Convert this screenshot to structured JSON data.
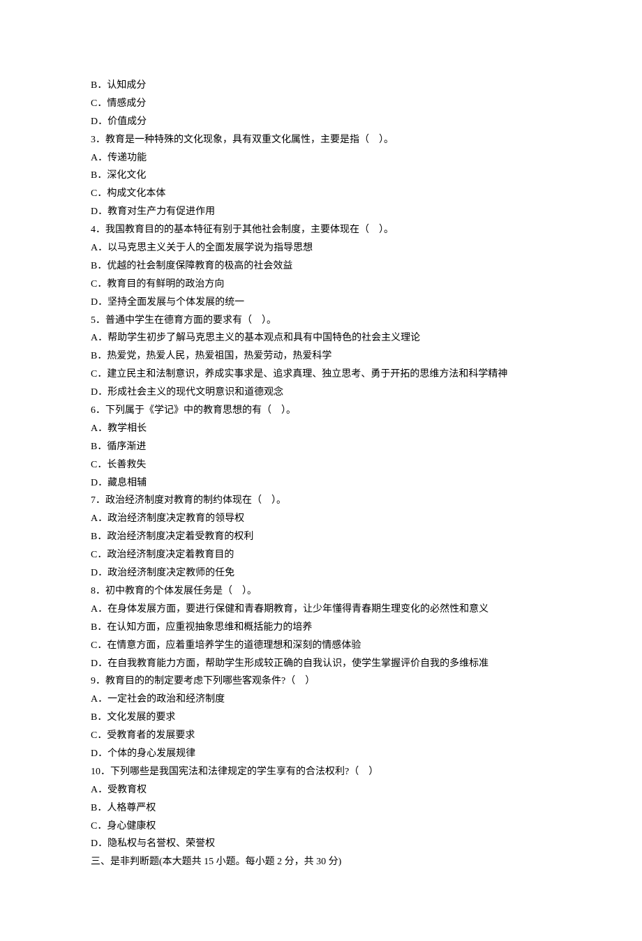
{
  "lines": [
    "B．认知成分",
    "C．情感成分",
    "D．价值成分",
    "3．教育是一种特殊的文化现象，具有双重文化属性，主要是指（　）。",
    "A．传递功能",
    "B．深化文化",
    "C．构成文化本体",
    "D．教育对生产力有促进作用",
    "4．我国教育目的的基本特征有别于其他社会制度，主要体现在（　）。",
    "A．以马克思主义关于人的全面发展学说为指导思想",
    "B．优越的社会制度保障教育的极高的社会效益",
    "C．教育目的有鲜明的政治方向",
    "D．坚持全面发展与个体发展的统一",
    "5．普通中学生在德育方面的要求有（　）。",
    "A．帮助学生初步了解马克思主义的基本观点和具有中国特色的社会主义理论",
    "B．热爱党，热爱人民，热爱祖国，热爱劳动，热爱科学",
    "C．建立民主和法制意识，养成实事求是、追求真理、独立思考、勇于开拓的思维方法和科学精神",
    "D．形成社会主义的现代文明意识和道德观念",
    "6．下列属于《学记》中的教育思想的有（　）。",
    "A．教学相长",
    "B．循序渐进",
    "C．长善救失",
    "D．藏息相辅",
    "7．政治经济制度对教育的制约体现在（　）。",
    "A．政治经济制度决定教育的领导权",
    "B．政治经济制度决定着受教育的权利",
    "C．政治经济制度决定着教育目的",
    "D．政治经济制度决定教师的任免",
    "8．初中教育的个体发展任务是（　）。",
    "A．在身体发展方面，要进行保健和青春期教育，让少年懂得青春期生理变化的必然性和意义",
    "B．在认知方面，应重视抽象思维和概括能力的培养",
    "C．在情意方面，应着重培养学生的道德理想和深刻的情感体验",
    "D．在自我教育能力方面，帮助学生形成较正确的自我认识，使学生掌握评价自我的多维标准",
    "9．教育目的的制定要考虑下列哪些客观条件?（　）",
    "A．一定社会的政治和经济制度",
    "B．文化发展的要求",
    "C．受教育者的发展要求",
    "D．个体的身心发展规律",
    "10．下列哪些是我国宪法和法律规定的学生享有的合法权利?（　）",
    "A．受教育权",
    "B．人格尊严权",
    "C．身心健康权",
    "D．隐私权与名誉权、荣誉权",
    "三、是非判断题(本大题共 15 小题。每小题 2 分，共 30 分)"
  ]
}
